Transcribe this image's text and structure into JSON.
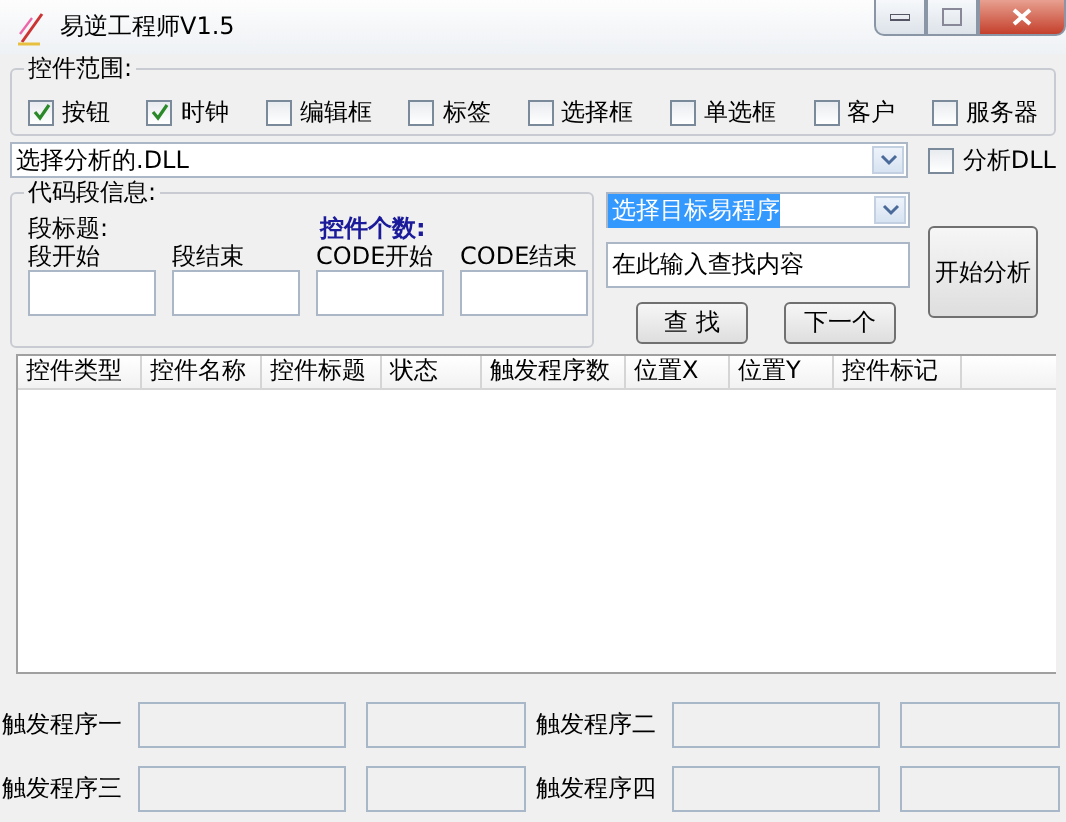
{
  "window": {
    "title": "易逆工程师V1.5"
  },
  "scope_group": {
    "title": "控件范围:",
    "options": [
      {
        "label": "按钮",
        "checked": true
      },
      {
        "label": "时钟",
        "checked": true
      },
      {
        "label": "编辑框",
        "checked": false
      },
      {
        "label": "标签",
        "checked": false
      },
      {
        "label": "选择框",
        "checked": false
      },
      {
        "label": "单选框",
        "checked": false
      },
      {
        "label": "客户",
        "checked": false
      },
      {
        "label": "服务器",
        "checked": false
      }
    ]
  },
  "dll_select": {
    "value": "选择分析的.DLL"
  },
  "analyze_dll": {
    "label": "分析DLL",
    "checked": false
  },
  "code_group": {
    "title": "代码段信息:",
    "section_title_label": "段标题:",
    "count_label": "控件个数:",
    "fields": [
      {
        "label": "段开始"
      },
      {
        "label": "段结束"
      },
      {
        "label": "CODE开始"
      },
      {
        "label": "CODE结束"
      }
    ]
  },
  "target_select": {
    "value": "选择目标易程序",
    "text_selected": true
  },
  "search_field": {
    "value": "在此输入查找内容"
  },
  "buttons": {
    "find": "查 找",
    "next": "下一个",
    "start": "开始分析"
  },
  "table": {
    "columns": [
      "控件类型",
      "控件名称",
      "控件标题",
      "状态",
      "触发程序数",
      "位置X",
      "位置Y",
      "控件标记"
    ]
  },
  "triggers": [
    {
      "label": "触发程序一"
    },
    {
      "label": "触发程序二"
    },
    {
      "label": "触发程序三"
    },
    {
      "label": "触发程序四"
    }
  ]
}
